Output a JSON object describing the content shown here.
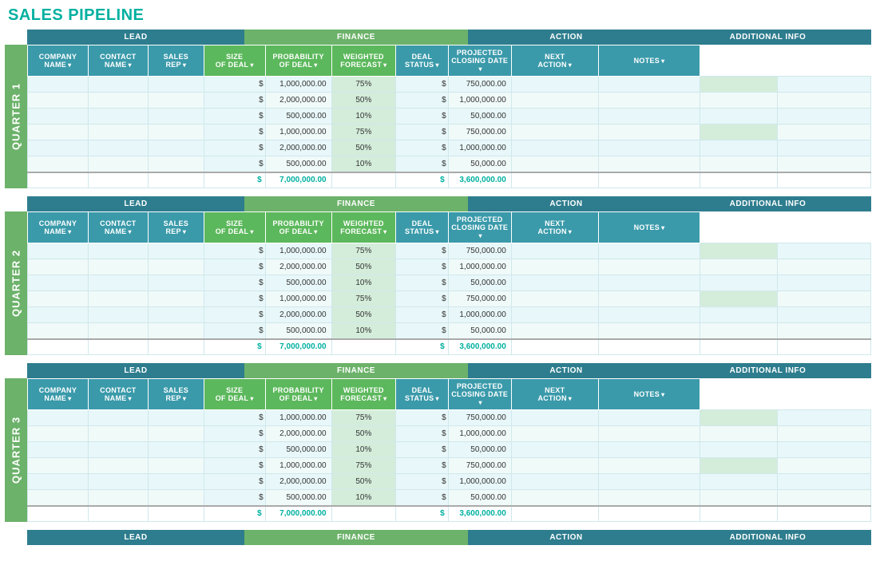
{
  "title": "SALES PIPELINE",
  "quarters": [
    {
      "label": "QUARTER 1",
      "id": "q1"
    },
    {
      "label": "QUARTER 2",
      "id": "q2"
    },
    {
      "label": "QUARTER 3",
      "id": "q3"
    }
  ],
  "categories": {
    "lead": "LEAD",
    "finance": "FINANCE",
    "action": "ACTION",
    "additional": "ADDITIONAL INFO"
  },
  "col_headers": {
    "company": "COMPANY NAME",
    "contact": "CONTACT NAME",
    "sales_rep": "SALES REP",
    "size_deal": "SIZE OF DEAL",
    "prob": "PROBABILITY OF DEAL",
    "weighted": "WEIGHTED FORECAST",
    "deal_status": "DEAL STATUS",
    "proj_close": "PROJECTED CLOSING DATE",
    "next_action": "NEXT ACTION",
    "notes": "NOTES"
  },
  "data_rows": [
    {
      "size": "1,000,000.00",
      "prob": "75%",
      "weighted": "750,000.00"
    },
    {
      "size": "2,000,000.00",
      "prob": "50%",
      "weighted": "1,000,000.00"
    },
    {
      "size": "500,000.00",
      "prob": "10%",
      "weighted": "50,000.00"
    },
    {
      "size": "1,000,000.00",
      "prob": "75%",
      "weighted": "750,000.00"
    },
    {
      "size": "2,000,000.00",
      "prob": "50%",
      "weighted": "1,000,000.00"
    },
    {
      "size": "500,000.00",
      "prob": "10%",
      "weighted": "50,000.00"
    }
  ],
  "totals": {
    "size": "7,000,000.00",
    "weighted": "3,600,000.00"
  },
  "bottom_label": "LEAD",
  "bottom_finance": "FINANCE",
  "bottom_action": "ACTION",
  "bottom_additional": "ADDITIONAL INFO"
}
